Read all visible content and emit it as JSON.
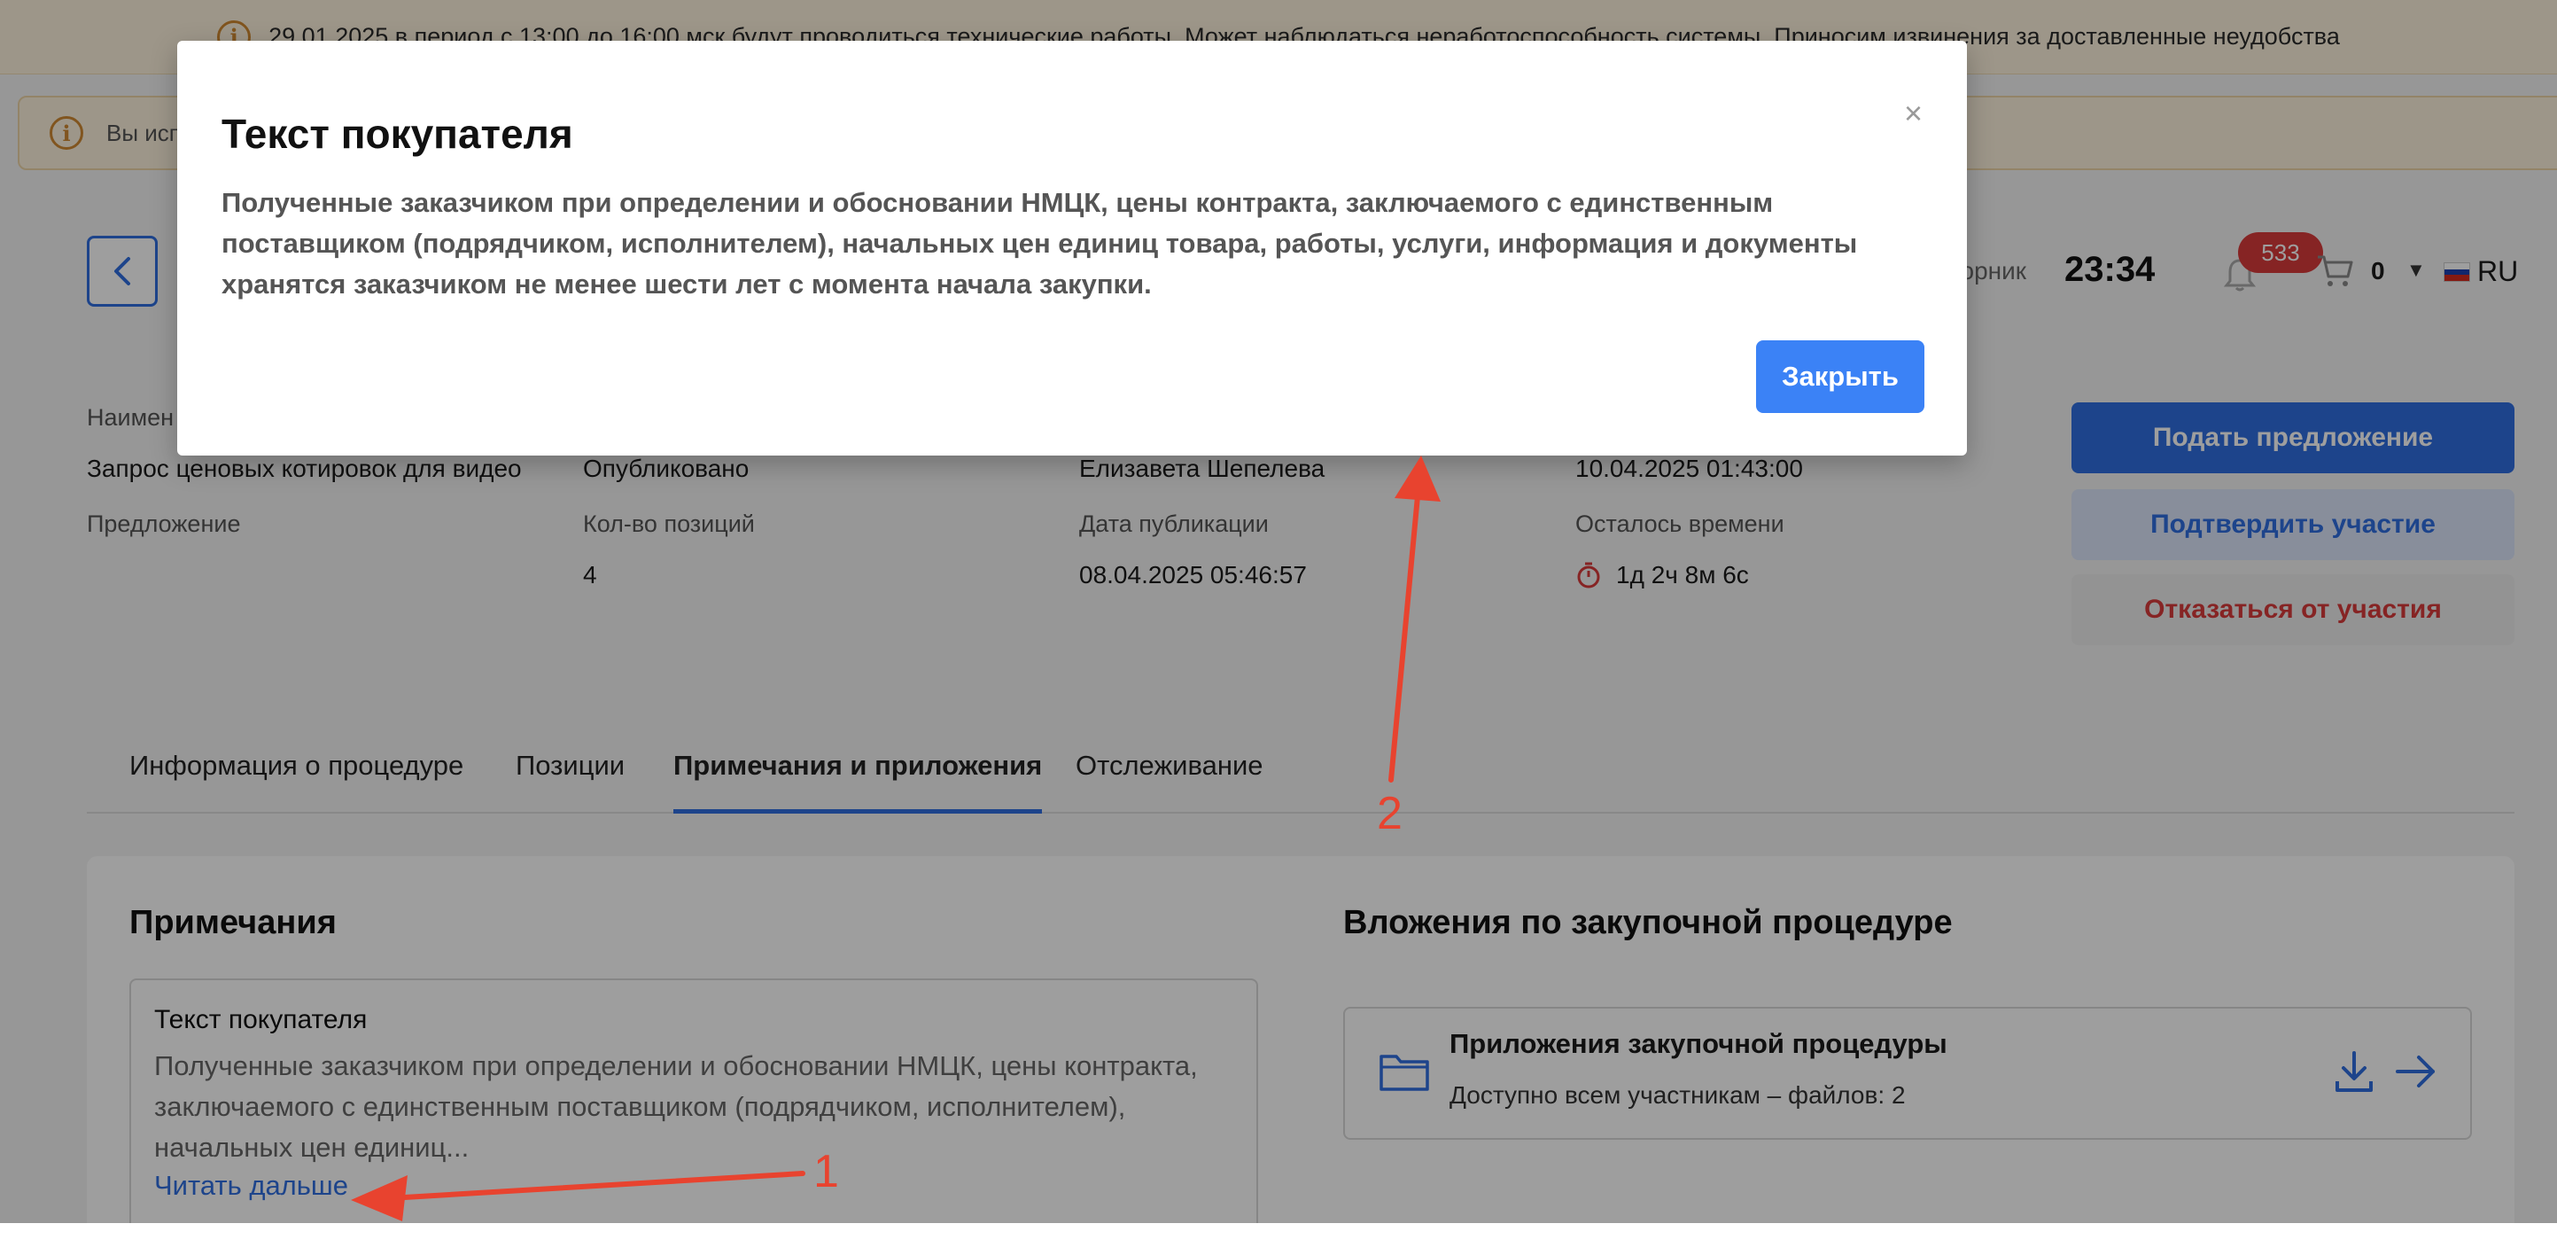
{
  "banner": {
    "text": "29.01.2025 в период с 13:00 до 16:00 мск будут проводиться технические работы. Может наблюдаться неработоспособность системы. Приносим извинения за доставленные неудобства"
  },
  "alert": {
    "text": "Вы исп"
  },
  "header": {
    "day": "торник",
    "time": "23:34",
    "notif_count": "533",
    "cart_count": "0",
    "lang": "RU"
  },
  "fields": {
    "name_label": "Наимен",
    "name_value": "Запрос ценовых котировок для видео",
    "status_value": "Опубликовано",
    "author_value": "Елизавета Шепелева",
    "deadline_value": "10.04.2025 01:43:00",
    "offer_label": "Предложение",
    "positions_label": "Кол-во позиций",
    "positions_value": "4",
    "pub_label": "Дата публикации",
    "pub_value": "08.04.2025 05:46:57",
    "remaining_label": "Осталось времени",
    "remaining_value": "1д 2ч 8м 6с"
  },
  "actions": {
    "submit": "Подать предложение",
    "confirm": "Подтвердить участие",
    "decline": "Отказаться от участия"
  },
  "tabs": [
    {
      "label": "Информация о процедуре"
    },
    {
      "label": "Позиции"
    },
    {
      "label": "Примечания и приложения"
    },
    {
      "label": "Отслеживание"
    }
  ],
  "notes": {
    "heading": "Примечания",
    "card_title": "Текст покупателя",
    "card_text": "Полученные заказчиком при определении и обосновании НМЦК, цены контракта, заключаемого с единственным поставщиком (подрядчиком, исполнителем), начальных цен единиц...",
    "read_more": "Читать дальше"
  },
  "attachments": {
    "heading": "Вложения по закупочной процедуре",
    "title": "Приложения закупочной процедуры",
    "subtitle": "Доступно всем участникам – файлов: 2"
  },
  "modal": {
    "title": "Текст покупателя",
    "body": "Полученные заказчиком при определении и обосновании НМЦК, цены контракта, заключаемого с единственным поставщиком (подрядчиком, исполнителем), начальных цен единиц товара, работы, услуги, информация и документы хранятся заказчиком не менее шести лет с момента начала закупки.",
    "close_button": "Закрыть",
    "close_icon": "×"
  },
  "annotations": {
    "one": "1",
    "two": "2"
  },
  "colors": {
    "accent": "#2f6fe0",
    "danger": "#d93b3b",
    "banner_bg": "#fdf3de",
    "annotation": "#e8432f"
  },
  "icons": [
    "info-icon",
    "chevron-left-icon",
    "bell-icon",
    "cart-icon",
    "flag-ru-icon",
    "timer-icon",
    "folder-icon",
    "download-icon",
    "arrow-right-icon",
    "close-icon"
  ]
}
